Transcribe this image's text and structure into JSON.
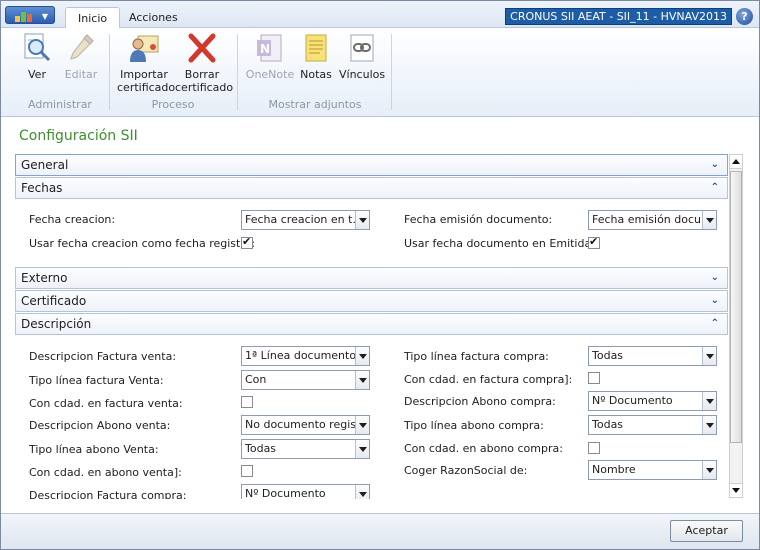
{
  "window": {
    "title": "CRONUS SII AEAT - SII_11 - HVNAV2013",
    "help": "?"
  },
  "tabs": [
    {
      "label": "Inicio",
      "active": true
    },
    {
      "label": "Acciones",
      "active": false
    }
  ],
  "ribbon": {
    "groups": [
      {
        "label": "Administrar",
        "buttons": [
          {
            "label": "Ver",
            "icon": "view-icon",
            "enabled": true
          },
          {
            "label": "Editar",
            "icon": "edit-pencil-icon",
            "enabled": false
          }
        ]
      },
      {
        "label": "Proceso",
        "buttons": [
          {
            "label": "Importar certificado",
            "icon": "import-certificate-icon",
            "enabled": true
          },
          {
            "label": "Borrar certificado",
            "icon": "delete-x-icon",
            "enabled": true
          }
        ]
      },
      {
        "label": "Mostrar adjuntos",
        "buttons": [
          {
            "label": "OneNote",
            "icon": "onenote-icon",
            "enabled": false
          },
          {
            "label": "Notas",
            "icon": "notes-icon",
            "enabled": true
          },
          {
            "label": "Vínculos",
            "icon": "links-icon",
            "enabled": true
          }
        ]
      }
    ]
  },
  "page_title": "Configuración SII",
  "fasttabs": {
    "general": "General",
    "fechas": "Fechas",
    "externo": "Externo",
    "certificado": "Certificado",
    "descripcion": "Descripción"
  },
  "fechas": {
    "fecha_creacion": {
      "label": "Fecha creacion:",
      "value": "Fecha creacion en t..."
    },
    "usar_fecha_creacion": {
      "label": "Usar fecha creacion como fecha registro:",
      "checked": true
    },
    "fecha_emision": {
      "label": "Fecha emisión documento:",
      "value": "Fecha emisión docu..."
    },
    "usar_fecha_documento": {
      "label": "Usar fecha documento en Emitidas:",
      "checked": true
    }
  },
  "descripcion": {
    "left": [
      {
        "label": "Descripcion Factura venta:",
        "type": "dropdown",
        "value": "1ª Línea documento"
      },
      {
        "label": "Tipo línea factura Venta:",
        "type": "dropdown",
        "value": "Con"
      },
      {
        "label": "Con cdad. en factura venta:",
        "type": "checkbox",
        "checked": false
      },
      {
        "label": "Descripcion Abono venta:",
        "type": "dropdown",
        "value": "No documento regis..."
      },
      {
        "label": "Tipo línea abono Venta:",
        "type": "dropdown",
        "value": "Todas"
      },
      {
        "label": "Con cdad. en abono venta]:",
        "type": "checkbox",
        "checked": false
      },
      {
        "label": "Descripcion Factura compra:",
        "type": "dropdown",
        "value": "Nº Documento"
      }
    ],
    "right": [
      {
        "label": "Tipo línea factura compra:",
        "type": "dropdown",
        "value": "Todas"
      },
      {
        "label": "Con cdad. en factura compra]:",
        "type": "checkbox",
        "checked": false
      },
      {
        "label": "Descripcion Abono compra:",
        "type": "dropdown",
        "value": "Nº Documento"
      },
      {
        "label": "Tipo línea abono compra:",
        "type": "dropdown",
        "value": "Todas"
      },
      {
        "label": "Con cdad. en abono compra:",
        "type": "checkbox",
        "checked": false
      },
      {
        "label": "Coger RazonSocial de:",
        "type": "dropdown",
        "value": "Nombre"
      }
    ]
  },
  "footer": {
    "accept_label": "Aceptar"
  },
  "colors": {
    "accent": "#1d5da8",
    "title_green": "#3d8f2d"
  }
}
